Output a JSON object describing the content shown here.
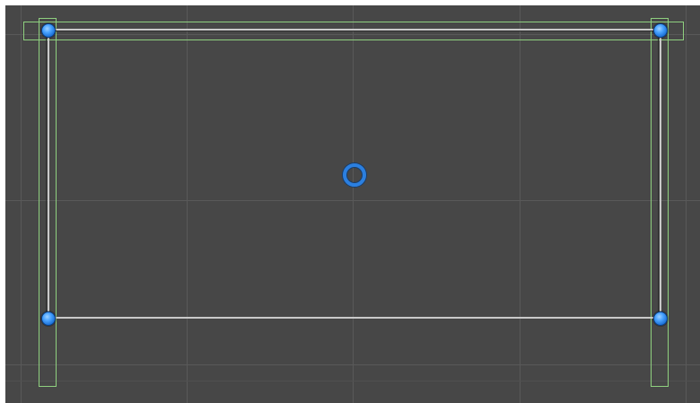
{
  "scene": {
    "background_color": "#474747",
    "grid_color": "#595959",
    "collider_color": "#8fd07f",
    "edge_color": "#c9c9c9",
    "handle_color": "#2b7fe0"
  },
  "handles": [
    {
      "name": "top-left"
    },
    {
      "name": "top-right"
    },
    {
      "name": "bottom-left"
    },
    {
      "name": "bottom-right"
    }
  ],
  "pivot": {
    "name": "center-pivot"
  }
}
